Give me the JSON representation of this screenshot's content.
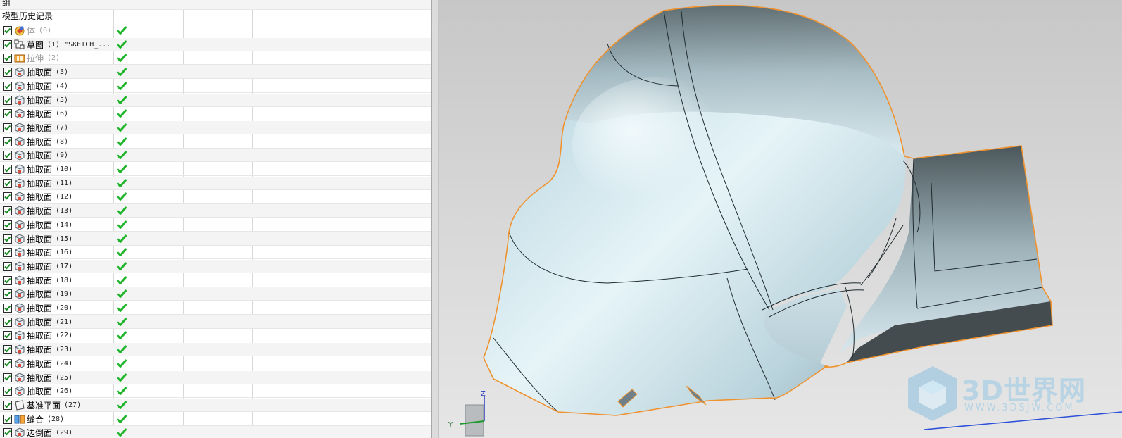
{
  "navigator": {
    "group_header": "组",
    "history_header": "模型历史记录",
    "features": [
      {
        "icon": "body-icon",
        "label": "体",
        "num": "(0)",
        "dim": true
      },
      {
        "icon": "sketch-icon",
        "label": "草图",
        "num": "(1) \"SKETCH_...",
        "dim": false
      },
      {
        "icon": "extrude-icon",
        "label": "拉伸",
        "num": "(2)",
        "dim": true
      },
      {
        "icon": "extract-face-icon",
        "label": "抽取面",
        "num": "(3)",
        "dim": false
      },
      {
        "icon": "extract-face-icon",
        "label": "抽取面",
        "num": "(4)",
        "dim": false
      },
      {
        "icon": "extract-face-icon",
        "label": "抽取面",
        "num": "(5)",
        "dim": false
      },
      {
        "icon": "extract-face-icon",
        "label": "抽取面",
        "num": "(6)",
        "dim": false
      },
      {
        "icon": "extract-face-icon",
        "label": "抽取面",
        "num": "(7)",
        "dim": false
      },
      {
        "icon": "extract-face-icon",
        "label": "抽取面",
        "num": "(8)",
        "dim": false
      },
      {
        "icon": "extract-face-icon",
        "label": "抽取面",
        "num": "(9)",
        "dim": false
      },
      {
        "icon": "extract-face-icon",
        "label": "抽取面",
        "num": "(10)",
        "dim": false
      },
      {
        "icon": "extract-face-icon",
        "label": "抽取面",
        "num": "(11)",
        "dim": false
      },
      {
        "icon": "extract-face-icon",
        "label": "抽取面",
        "num": "(12)",
        "dim": false
      },
      {
        "icon": "extract-face-icon",
        "label": "抽取面",
        "num": "(13)",
        "dim": false
      },
      {
        "icon": "extract-face-icon",
        "label": "抽取面",
        "num": "(14)",
        "dim": false
      },
      {
        "icon": "extract-face-icon",
        "label": "抽取面",
        "num": "(15)",
        "dim": false
      },
      {
        "icon": "extract-face-icon",
        "label": "抽取面",
        "num": "(16)",
        "dim": false
      },
      {
        "icon": "extract-face-icon",
        "label": "抽取面",
        "num": "(17)",
        "dim": false
      },
      {
        "icon": "extract-face-icon",
        "label": "抽取面",
        "num": "(18)",
        "dim": false
      },
      {
        "icon": "extract-face-icon",
        "label": "抽取面",
        "num": "(19)",
        "dim": false
      },
      {
        "icon": "extract-face-icon",
        "label": "抽取面",
        "num": "(20)",
        "dim": false
      },
      {
        "icon": "extract-face-icon",
        "label": "抽取面",
        "num": "(21)",
        "dim": false
      },
      {
        "icon": "extract-face-icon",
        "label": "抽取面",
        "num": "(22)",
        "dim": false
      },
      {
        "icon": "extract-face-icon",
        "label": "抽取面",
        "num": "(23)",
        "dim": false
      },
      {
        "icon": "extract-face-icon",
        "label": "抽取面",
        "num": "(24)",
        "dim": false
      },
      {
        "icon": "extract-face-icon",
        "label": "抽取面",
        "num": "(25)",
        "dim": false
      },
      {
        "icon": "extract-face-icon",
        "label": "抽取面",
        "num": "(26)",
        "dim": false
      },
      {
        "icon": "datum-plane-icon",
        "label": "基准平面",
        "num": "(27)",
        "dim": false
      },
      {
        "icon": "sew-icon",
        "label": "缝合",
        "num": "(28)",
        "dim": false
      },
      {
        "icon": "extract-face-icon",
        "label": "边倒面",
        "num": "(29)",
        "dim": false
      }
    ]
  },
  "viewport": {
    "axis_labels": {
      "z": "Z",
      "y": "Y"
    },
    "watermark": {
      "brand": "3D世界网",
      "url": "WWW.3DSJW.COM"
    }
  },
  "colors": {
    "check_green": "#1fb52a",
    "edge_orange": "#f0922e",
    "surface_light": "#dfeff5",
    "surface_dark": "#4b5558"
  }
}
